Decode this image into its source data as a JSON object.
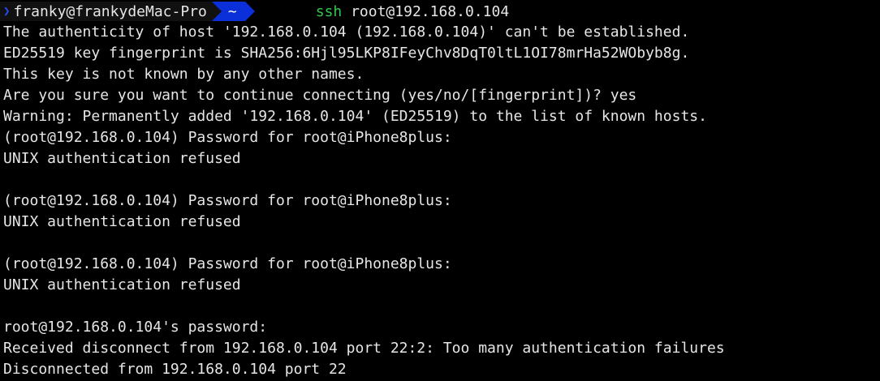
{
  "prompt": {
    "chevron": "❯",
    "user_host": "franky@frankydeMac-Pro",
    "dir": "~",
    "command_name": "ssh",
    "command_args": " root@192.168.0.104",
    "colors": {
      "dir_bg": "#0b2fd8",
      "command": "#31c750"
    }
  },
  "output_lines": [
    "The authenticity of host '192.168.0.104 (192.168.0.104)' can't be established.",
    "ED25519 key fingerprint is SHA256:6Hjl95LKP8IFeyChv8DqT0ltL1OI78mrHa52WObyb8g.",
    "This key is not known by any other names.",
    "Are you sure you want to continue connecting (yes/no/[fingerprint])? yes",
    "Warning: Permanently added '192.168.0.104' (ED25519) to the list of known hosts.",
    "(root@192.168.0.104) Password for root@iPhone8plus:",
    "UNIX authentication refused",
    "",
    "(root@192.168.0.104) Password for root@iPhone8plus:",
    "UNIX authentication refused",
    "",
    "(root@192.168.0.104) Password for root@iPhone8plus:",
    "UNIX authentication refused",
    "",
    "root@192.168.0.104's password:",
    "Received disconnect from 192.168.0.104 port 22:2: Too many authentication failures",
    "Disconnected from 192.168.0.104 port 22"
  ]
}
